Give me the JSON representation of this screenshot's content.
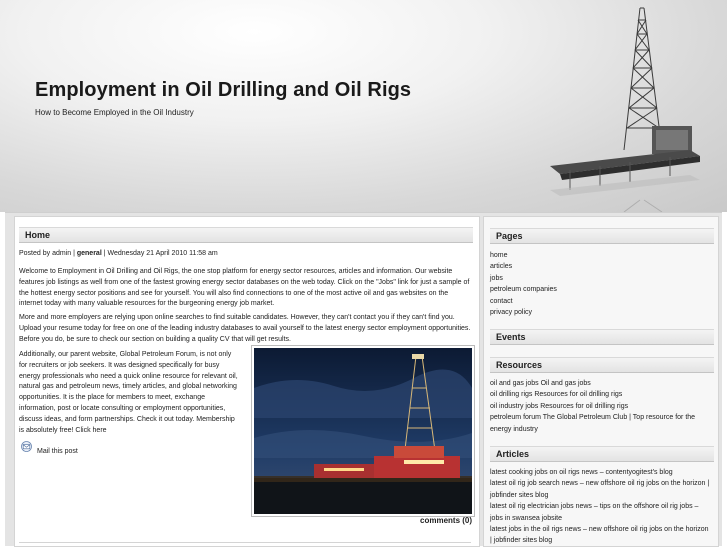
{
  "header": {
    "title": "Employment in Oil Drilling and Oil Rigs",
    "tagline": "How to Become Employed in the Oil Industry"
  },
  "post": {
    "heading": "Home",
    "meta_prefix": "Posted by admin | ",
    "meta_category": "general",
    "meta_suffix": " | Wednesday 21 April 2010 11:58 am",
    "paragraph1": "Welcome to Employment in Oil Drilling and Oil Rigs, the one stop platform for energy sector resources, articles and information. Our website features job listings as well from one of the fastest growing energy sector databases on the web today. Click on the \"Jobs\" link for just a sample of the hottest energy sector positions and see for yourself. You will also find connections to one of the most active oil and gas websites on the internet today with many valuable resources for the burgeoning energy job market.",
    "paragraph2": "More and more employers are relying upon online searches to find suitable candidates. However, they can't contact you if they can't find you. Upload your resume today for free on one of the leading industry databases to avail yourself to the latest energy sector employment opportunities. Before you do, be sure to check our section on building a quality CV that will get results.",
    "paragraph3": "Additionally, our parent website, Global Petroleum Forum, is not only for recruiters or job seekers. It was designed specifically for busy energy professionals who need a quick online resource for relevant oil, natural gas and petroleum news, timely articles, and global networking opportunities. It is the place for members to meet, exchange information, post or locate consulting or employment opportunities, discuss ideas, and form partnerships. Check it out today. Membership is absolutely free! Click here",
    "mail_label": "Mail this post",
    "comments_label": "comments (0)"
  },
  "sidebar": {
    "pages_heading": "Pages",
    "pages": [
      "home",
      "articles",
      "jobs",
      "petroleum companies",
      "contact",
      "privacy policy"
    ],
    "events_heading": "Events",
    "resources_heading": "Resources",
    "resources": [
      "oil and gas jobs Oil and gas jobs",
      "oil drilling rigs Resources for oil drilling rigs",
      "oil industry jobs Resources for oil drilling rigs",
      "petroleum forum The Global Petroleum Club | Top resource for the energy industry"
    ],
    "articles_heading": "Articles",
    "articles": [
      "latest cooking jobs on oil rigs news – contentyogitest's blog",
      "latest oil rig job search news – new offshore oil rig jobs on the horizon | jobfinder sites blog",
      "latest oil rig electrician jobs news – tips on the offshore oil rig jobs – jobs in swansea jobsite",
      "latest jobs in the oil rigs news – new offshore oil rig jobs on the horizon | jobfinder sites blog"
    ]
  },
  "colors": {
    "header_light": "#f1f1f1",
    "header_dark": "#c9c9c9",
    "frame": "#e4e4e4",
    "sidebar_bg": "#f7f7f7",
    "text": "#222222"
  },
  "icons": {
    "mail": "mail-icon",
    "logo": "oil-rig-logo"
  }
}
